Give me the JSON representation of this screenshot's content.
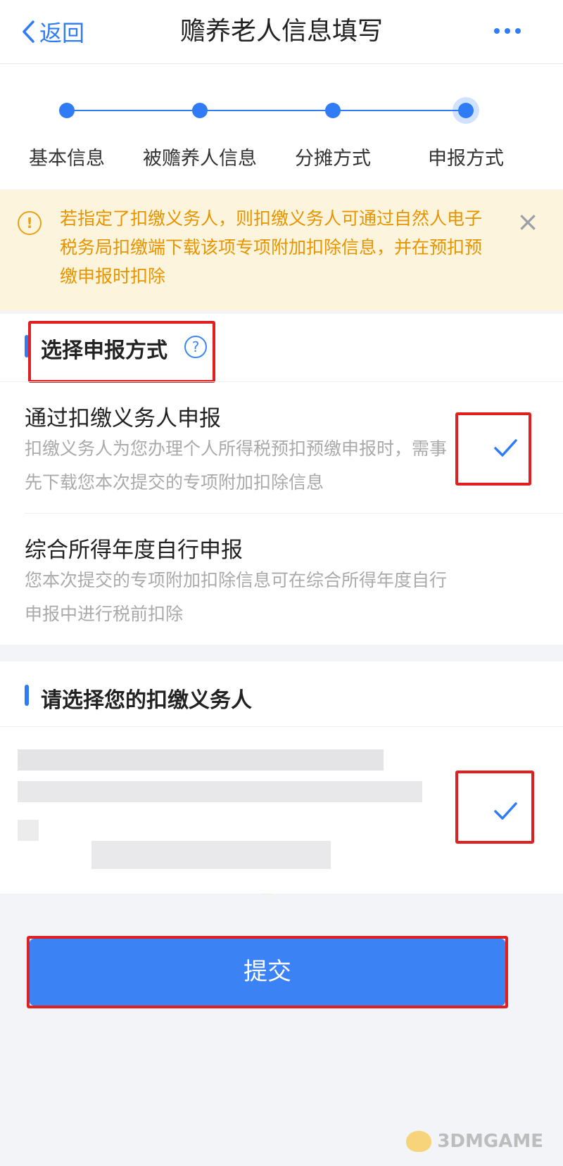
{
  "header": {
    "back_label": "返回",
    "title": "赡养老人信息填写"
  },
  "steps": [
    {
      "label": "基本信息"
    },
    {
      "label": "被赡养人信息"
    },
    {
      "label": "分摊方式"
    },
    {
      "label": "申报方式"
    }
  ],
  "notice": {
    "text": "若指定了扣缴义务人，则扣缴义务人可通过自然人电子税务局扣缴端下载该项专项附加扣除信息，并在预扣预缴申报时扣除"
  },
  "report_method": {
    "section_title": "选择申报方式",
    "options": [
      {
        "title": "通过扣缴义务人申报",
        "desc": "扣缴义务人为您办理个人所得税预扣预缴申报时，需事先下载您本次提交的专项附加扣除信息",
        "checked": true
      },
      {
        "title": "综合所得年度自行申报",
        "desc": "您本次提交的专项附加扣除信息可在综合所得年度自行申报中进行税前扣除",
        "checked": false
      }
    ]
  },
  "withholding": {
    "section_title": "请选择您的扣缴义务人"
  },
  "submit_label": "提交",
  "watermark": "3DMGAME",
  "colors": {
    "accent": "#2f7cf6",
    "notice_bg": "#fdf4dd",
    "notice_text": "#e69500",
    "highlight_red": "#e02020"
  }
}
